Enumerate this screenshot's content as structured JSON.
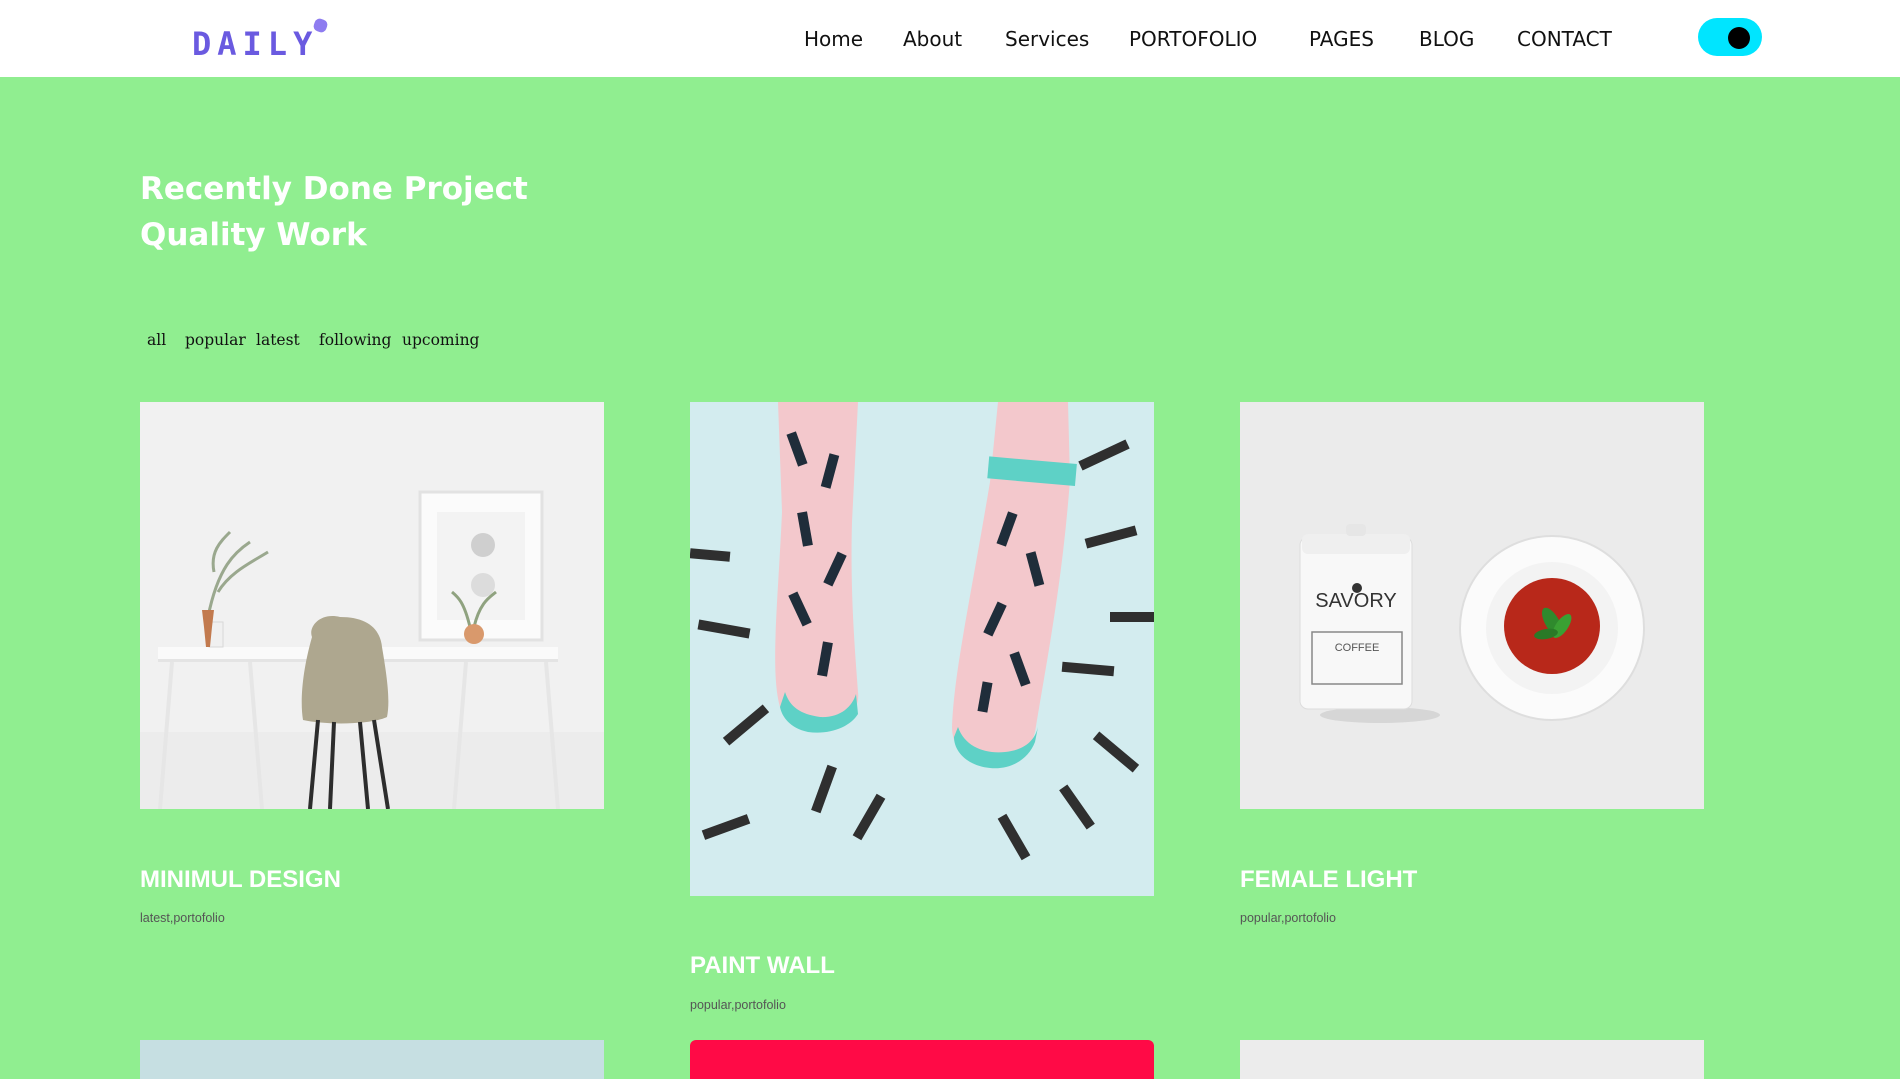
{
  "brand": {
    "logo_text": "DAILY",
    "accent": "#6a5ae0"
  },
  "nav": {
    "items": [
      {
        "label": "Home"
      },
      {
        "label": "About"
      },
      {
        "label": "Services"
      },
      {
        "label": "PORTOFOLIO"
      },
      {
        "label": "PAGES"
      },
      {
        "label": "BLOG"
      },
      {
        "label": "CONTACT"
      }
    ],
    "theme_toggle": {
      "on": true,
      "color": "#00e5ff"
    }
  },
  "section": {
    "title_line1": "Recently Done Project",
    "title_line2": "Quality Work",
    "background": "#90ee90"
  },
  "filters": [
    {
      "label": "all"
    },
    {
      "label": "popular"
    },
    {
      "label": "latest"
    },
    {
      "label": "following"
    },
    {
      "label": "upcoming"
    }
  ],
  "projects": [
    {
      "title": "MINIMUL DESIGN",
      "tags": "latest,portofolio",
      "image": "desk-chair-photo"
    },
    {
      "title": "PAINT WALL",
      "tags": "popular,portofolio",
      "image": "patterned-socks-photo"
    },
    {
      "title": "FEMALE LIGHT",
      "tags": "popular,portofolio",
      "image": "coffee-soup-photo"
    }
  ],
  "next_row": [
    {
      "image": "pale-blue-photo"
    },
    {
      "image": "red-photo"
    },
    {
      "image": "light-grey-photo"
    }
  ]
}
